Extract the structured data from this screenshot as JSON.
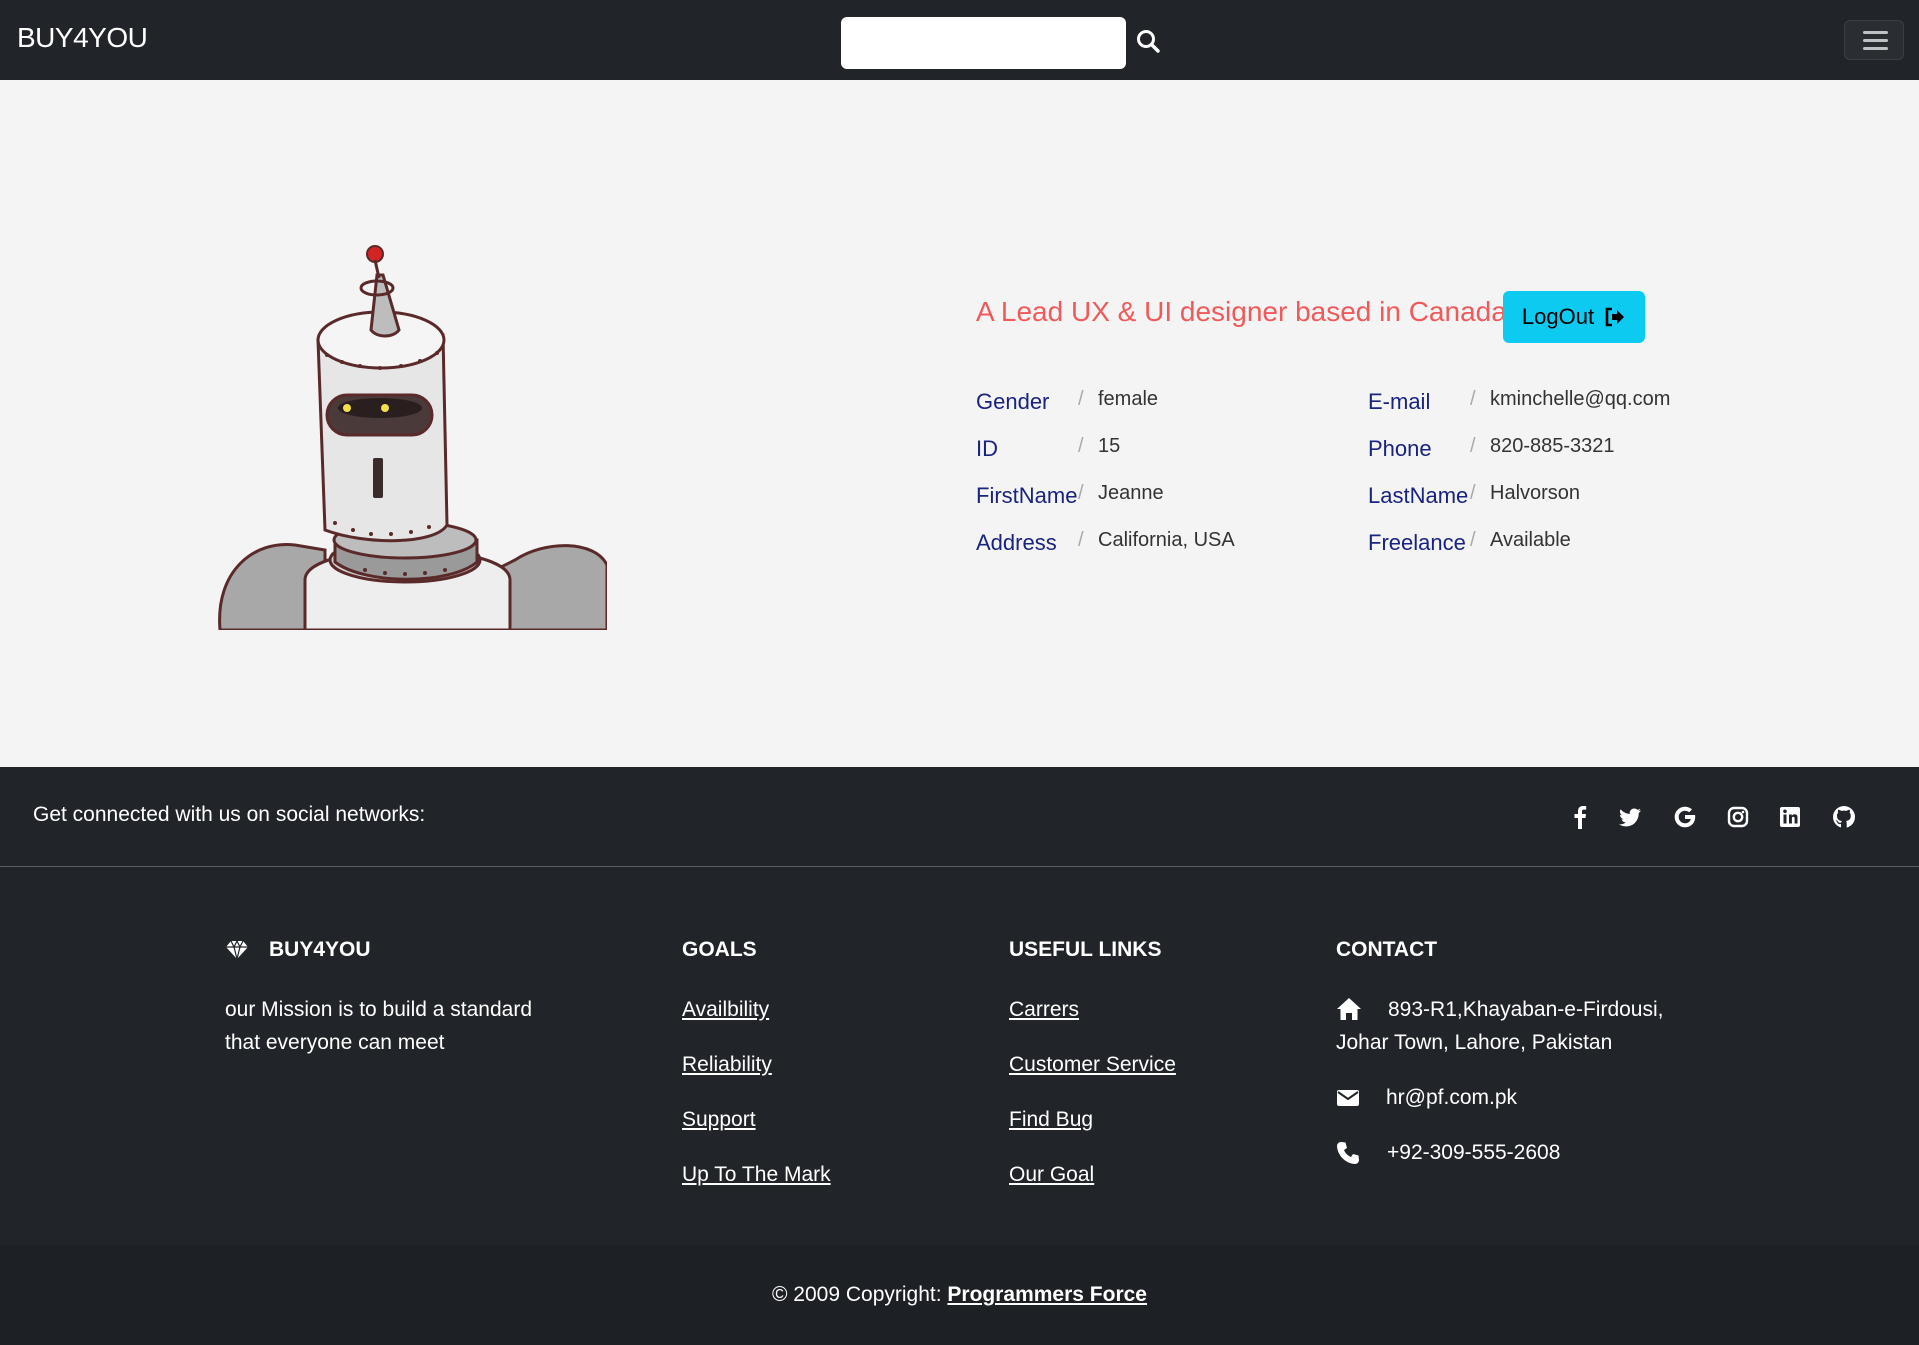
{
  "navbar": {
    "brand": "BUY4YOU",
    "search_placeholder": "",
    "search_icon": "search-icon",
    "menu_icon": "hamburger-icon"
  },
  "profile": {
    "headline": "A Lead UX & UI designer based in Canada",
    "logout_label": "LogOut",
    "logout_icon": "sign-out-icon",
    "fields": [
      {
        "label": "Gender",
        "sep": "/",
        "value": "female"
      },
      {
        "label": "E-mail",
        "sep": "/",
        "value": "kminchelle@qq.com"
      },
      {
        "label": "ID",
        "sep": "/",
        "value": "15"
      },
      {
        "label": "Phone",
        "sep": "/",
        "value": "820-885-3321"
      },
      {
        "label": "FirstName",
        "sep": "/",
        "value": "Jeanne"
      },
      {
        "label": "LastName",
        "sep": "/",
        "value": "Halvorson"
      },
      {
        "label": "Address",
        "sep": "/",
        "value": "California, USA"
      },
      {
        "label": "Freelance",
        "sep": "/",
        "value": "Available"
      }
    ]
  },
  "footer": {
    "social_text": "Get connected with us on social networks:",
    "social_icons": [
      "facebook-icon",
      "twitter-icon",
      "google-icon",
      "instagram-icon",
      "linkedin-icon",
      "github-icon"
    ],
    "brand": "BUY4YOU",
    "mission_line1": "our Mission is to build a standard",
    "mission_line2": "that everyone can meet",
    "goals_title": "GOALS",
    "goals": [
      "Availbility",
      "Reliability",
      "Support",
      "Up To The Mark"
    ],
    "links_title": "USEFUL LINKS",
    "links": [
      "Carrers",
      "Customer Service",
      "Find Bug",
      "Our Goal"
    ],
    "contact_title": "CONTACT",
    "address_line1": "893-R1,Khayaban-e-Firdousi,",
    "address_line2": "Johar Town, Lahore, Pakistan",
    "email": "hr@pf.com.pk",
    "phone": "+92-309-555-2608",
    "copyright_prefix": "© 2009 Copyright:",
    "copyright_link": "Programmers Force"
  }
}
